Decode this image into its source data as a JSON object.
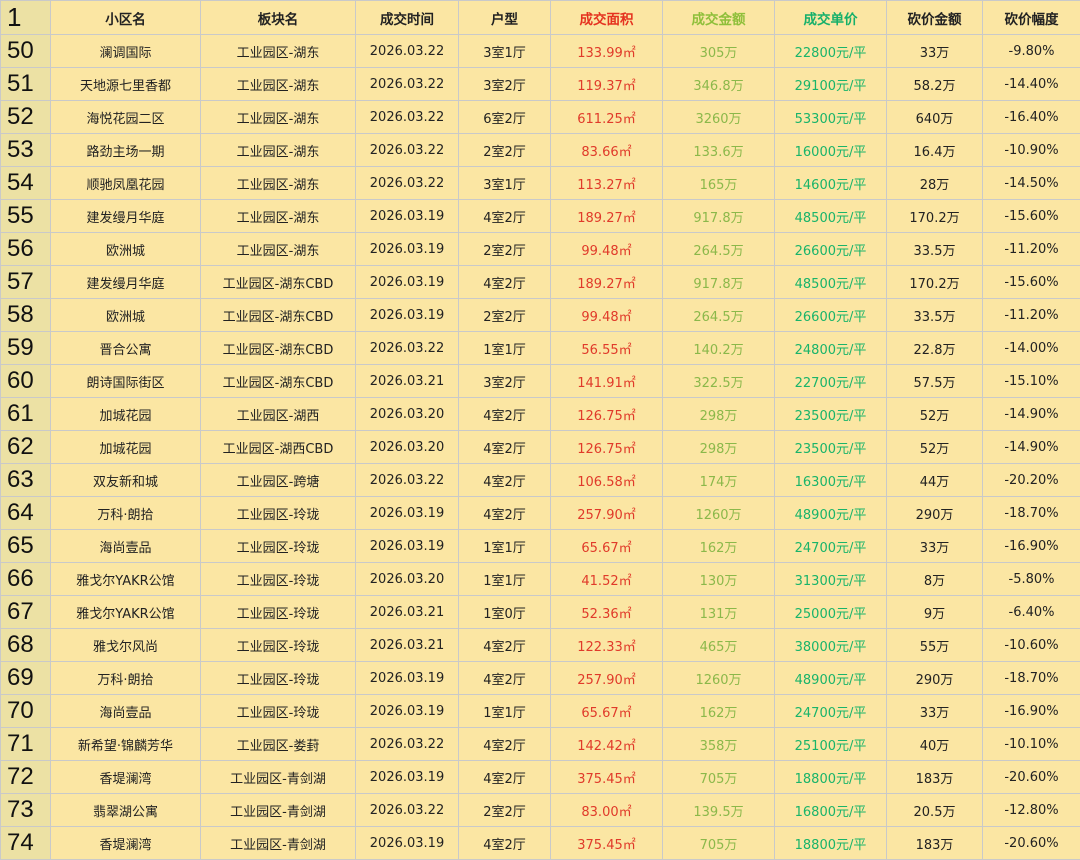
{
  "spreadsheet": {
    "header_row_number": "1",
    "headers": [
      "小区名",
      "板块名",
      "成交时间",
      "户型",
      "成交面积",
      "成交金额",
      "成交单价",
      "砍价金额",
      "砍价幅度"
    ],
    "rows": [
      {
        "n": "50",
        "name": "澜调国际",
        "block": "工业园区-湖东",
        "date": "2026.03.22",
        "layout": "3室1厅",
        "area": "133.99㎡",
        "amount": "305万",
        "unit_price": "22800元/平",
        "cut": "33万",
        "pct": "-9.80%"
      },
      {
        "n": "51",
        "name": "天地源七里香都",
        "block": "工业园区-湖东",
        "date": "2026.03.22",
        "layout": "3室2厅",
        "area": "119.37㎡",
        "amount": "346.8万",
        "unit_price": "29100元/平",
        "cut": "58.2万",
        "pct": "-14.40%"
      },
      {
        "n": "52",
        "name": "海悦花园二区",
        "block": "工业园区-湖东",
        "date": "2026.03.22",
        "layout": "6室2厅",
        "area": "611.25㎡",
        "amount": "3260万",
        "unit_price": "53300元/平",
        "cut": "640万",
        "pct": "-16.40%"
      },
      {
        "n": "53",
        "name": "路劲主场一期",
        "block": "工业园区-湖东",
        "date": "2026.03.22",
        "layout": "2室2厅",
        "area": "83.66㎡",
        "amount": "133.6万",
        "unit_price": "16000元/平",
        "cut": "16.4万",
        "pct": "-10.90%"
      },
      {
        "n": "54",
        "name": "顺驰凤凰花园",
        "block": "工业园区-湖东",
        "date": "2026.03.22",
        "layout": "3室1厅",
        "area": "113.27㎡",
        "amount": "165万",
        "unit_price": "14600元/平",
        "cut": "28万",
        "pct": "-14.50%"
      },
      {
        "n": "55",
        "name": "建发缦月华庭",
        "block": "工业园区-湖东",
        "date": "2026.03.19",
        "layout": "4室2厅",
        "area": "189.27㎡",
        "amount": "917.8万",
        "unit_price": "48500元/平",
        "cut": "170.2万",
        "pct": "-15.60%"
      },
      {
        "n": "56",
        "name": "欧洲城",
        "block": "工业园区-湖东",
        "date": "2026.03.19",
        "layout": "2室2厅",
        "area": "99.48㎡",
        "amount": "264.5万",
        "unit_price": "26600元/平",
        "cut": "33.5万",
        "pct": "-11.20%"
      },
      {
        "n": "57",
        "name": "建发缦月华庭",
        "block": "工业园区-湖东CBD",
        "date": "2026.03.19",
        "layout": "4室2厅",
        "area": "189.27㎡",
        "amount": "917.8万",
        "unit_price": "48500元/平",
        "cut": "170.2万",
        "pct": "-15.60%"
      },
      {
        "n": "58",
        "name": "欧洲城",
        "block": "工业园区-湖东CBD",
        "date": "2026.03.19",
        "layout": "2室2厅",
        "area": "99.48㎡",
        "amount": "264.5万",
        "unit_price": "26600元/平",
        "cut": "33.5万",
        "pct": "-11.20%"
      },
      {
        "n": "59",
        "name": "晋合公寓",
        "block": "工业园区-湖东CBD",
        "date": "2026.03.22",
        "layout": "1室1厅",
        "area": "56.55㎡",
        "amount": "140.2万",
        "unit_price": "24800元/平",
        "cut": "22.8万",
        "pct": "-14.00%"
      },
      {
        "n": "60",
        "name": "朗诗国际街区",
        "block": "工业园区-湖东CBD",
        "date": "2026.03.21",
        "layout": "3室2厅",
        "area": "141.91㎡",
        "amount": "322.5万",
        "unit_price": "22700元/平",
        "cut": "57.5万",
        "pct": "-15.10%"
      },
      {
        "n": "61",
        "name": "加城花园",
        "block": "工业园区-湖西",
        "date": "2026.03.20",
        "layout": "4室2厅",
        "area": "126.75㎡",
        "amount": "298万",
        "unit_price": "23500元/平",
        "cut": "52万",
        "pct": "-14.90%"
      },
      {
        "n": "62",
        "name": "加城花园",
        "block": "工业园区-湖西CBD",
        "date": "2026.03.20",
        "layout": "4室2厅",
        "area": "126.75㎡",
        "amount": "298万",
        "unit_price": "23500元/平",
        "cut": "52万",
        "pct": "-14.90%"
      },
      {
        "n": "63",
        "name": "双友新和城",
        "block": "工业园区-跨塘",
        "date": "2026.03.22",
        "layout": "4室2厅",
        "area": "106.58㎡",
        "amount": "174万",
        "unit_price": "16300元/平",
        "cut": "44万",
        "pct": "-20.20%"
      },
      {
        "n": "64",
        "name": "万科·朗拾",
        "block": "工业园区-玲珑",
        "date": "2026.03.19",
        "layout": "4室2厅",
        "area": "257.90㎡",
        "amount": "1260万",
        "unit_price": "48900元/平",
        "cut": "290万",
        "pct": "-18.70%"
      },
      {
        "n": "65",
        "name": "海尚壹品",
        "block": "工业园区-玲珑",
        "date": "2026.03.19",
        "layout": "1室1厅",
        "area": "65.67㎡",
        "amount": "162万",
        "unit_price": "24700元/平",
        "cut": "33万",
        "pct": "-16.90%"
      },
      {
        "n": "66",
        "name": "雅戈尔YAKR公馆",
        "block": "工业园区-玲珑",
        "date": "2026.03.20",
        "layout": "1室1厅",
        "area": "41.52㎡",
        "amount": "130万",
        "unit_price": "31300元/平",
        "cut": "8万",
        "pct": "-5.80%"
      },
      {
        "n": "67",
        "name": "雅戈尔YAKR公馆",
        "block": "工业园区-玲珑",
        "date": "2026.03.21",
        "layout": "1室0厅",
        "area": "52.36㎡",
        "amount": "131万",
        "unit_price": "25000元/平",
        "cut": "9万",
        "pct": "-6.40%"
      },
      {
        "n": "68",
        "name": "雅戈尔风尚",
        "block": "工业园区-玲珑",
        "date": "2026.03.21",
        "layout": "4室2厅",
        "area": "122.33㎡",
        "amount": "465万",
        "unit_price": "38000元/平",
        "cut": "55万",
        "pct": "-10.60%"
      },
      {
        "n": "69",
        "name": "万科·朗拾",
        "block": "工业园区-玲珑",
        "date": "2026.03.19",
        "layout": "4室2厅",
        "area": "257.90㎡",
        "amount": "1260万",
        "unit_price": "48900元/平",
        "cut": "290万",
        "pct": "-18.70%"
      },
      {
        "n": "70",
        "name": "海尚壹品",
        "block": "工业园区-玲珑",
        "date": "2026.03.19",
        "layout": "1室1厅",
        "area": "65.67㎡",
        "amount": "162万",
        "unit_price": "24700元/平",
        "cut": "33万",
        "pct": "-16.90%"
      },
      {
        "n": "71",
        "name": "新希望·锦麟芳华",
        "block": "工业园区-娄葑",
        "date": "2026.03.22",
        "layout": "4室2厅",
        "area": "142.42㎡",
        "amount": "358万",
        "unit_price": "25100元/平",
        "cut": "40万",
        "pct": "-10.10%"
      },
      {
        "n": "72",
        "name": "香堤澜湾",
        "block": "工业园区-青剑湖",
        "date": "2026.03.19",
        "layout": "4室2厅",
        "area": "375.45㎡",
        "amount": "705万",
        "unit_price": "18800元/平",
        "cut": "183万",
        "pct": "-20.60%"
      },
      {
        "n": "73",
        "name": "翡翠湖公寓",
        "block": "工业园区-青剑湖",
        "date": "2026.03.22",
        "layout": "2室2厅",
        "area": "83.00㎡",
        "amount": "139.5万",
        "unit_price": "16800元/平",
        "cut": "20.5万",
        "pct": "-12.80%"
      },
      {
        "n": "74",
        "name": "香堤澜湾",
        "block": "工业园区-青剑湖",
        "date": "2026.03.19",
        "layout": "4室2厅",
        "area": "375.45㎡",
        "amount": "705万",
        "unit_price": "18800元/平",
        "cut": "183万",
        "pct": "-20.60%"
      }
    ]
  },
  "colors": {
    "background": "#fbe6a3",
    "row_number_background": "#ece1a4",
    "area_text": "#e03a2a",
    "amount_text": "#8bb84a",
    "unit_price_text": "#19b46a",
    "grid_line": "#c9c9c9"
  }
}
